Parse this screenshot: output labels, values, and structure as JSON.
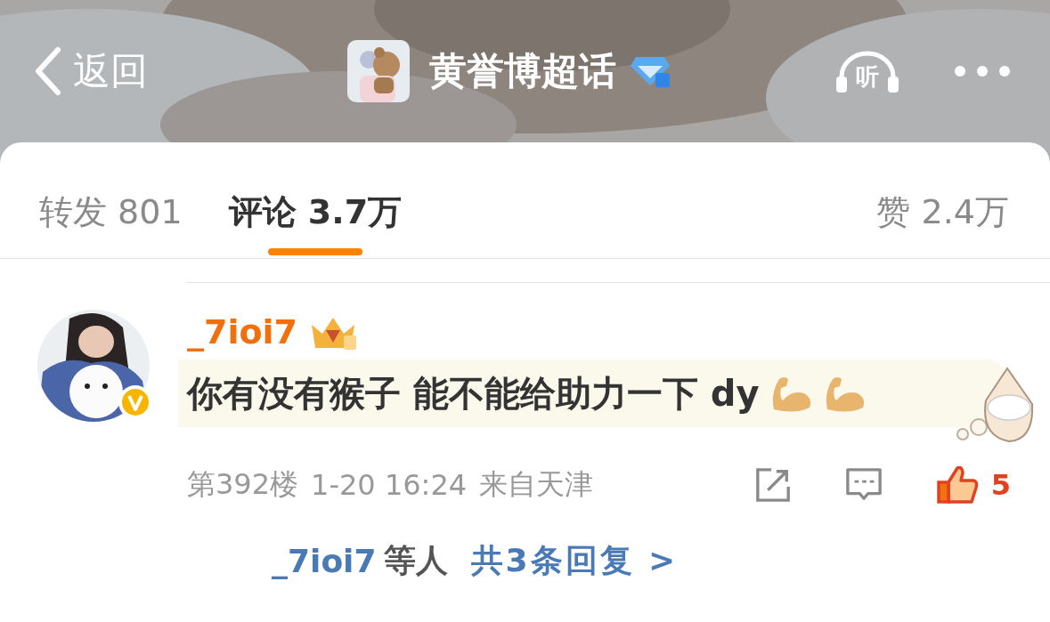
{
  "header": {
    "back_label": "返回",
    "title": "黄誉博超话",
    "listen_label": "听"
  },
  "tabs": [
    {
      "label": "转发",
      "count": "801",
      "selected": false
    },
    {
      "label": "评论",
      "count": "3.7万",
      "selected": true
    },
    {
      "label": "赞",
      "count": "2.4万",
      "selected": false
    }
  ],
  "comment": {
    "username": "_7ioi7",
    "verified": true,
    "text": "你有没有猴子 能不能给助力一下 dy",
    "emojis": [
      {
        "kind": "flexed-arm"
      },
      {
        "kind": "flexed-arm"
      }
    ],
    "floor": "第392楼",
    "time": "1-20 16:24",
    "location": "来自天津",
    "liked": true,
    "like_count": "5",
    "replies": {
      "users": "_7ioi7",
      "suffix": "等人",
      "link": "共3条回复 >"
    }
  }
}
